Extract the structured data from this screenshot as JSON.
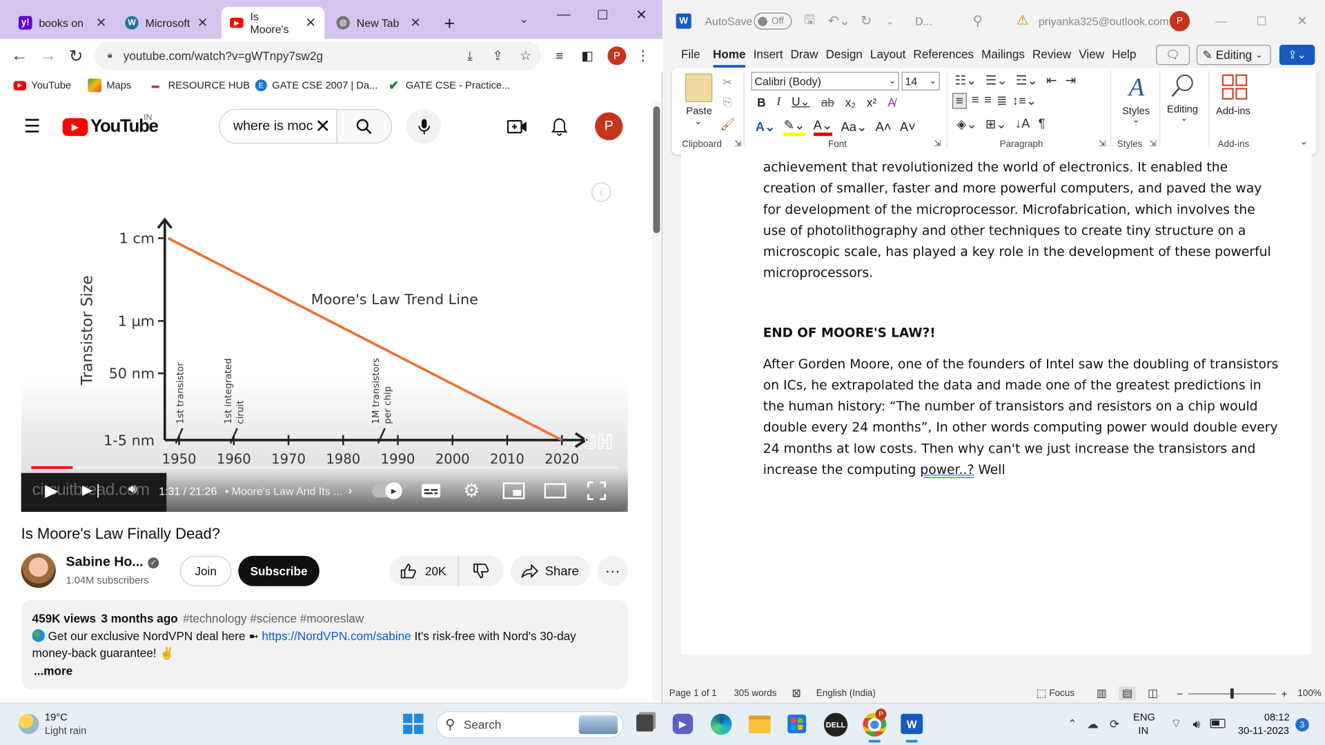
{
  "browser": {
    "tabs": [
      {
        "label": "books on",
        "icon": "yahoo-icon",
        "color": "#6001d2"
      },
      {
        "label": "Microsoft",
        "icon": "wordpress-icon",
        "color": "#21759b"
      },
      {
        "label": "Is Moore's",
        "icon": "youtube-icon",
        "color": "#ff0000"
      },
      {
        "label": "New Tab",
        "icon": "globe-icon",
        "color": "#555555"
      }
    ],
    "url": "youtube.com/watch?v=gWTnpy7sw2g",
    "profile_initial": "P",
    "bookmarks": [
      {
        "label": "YouTube",
        "icon": "youtube-icon"
      },
      {
        "label": "Maps",
        "icon": "maps-icon"
      },
      {
        "label": "RESOURCE HUB",
        "icon": "resource-icon"
      },
      {
        "label": "GATE CSE 2007 | Da...",
        "icon": "gate-icon"
      },
      {
        "label": "GATE CSE - Practice...",
        "icon": "check-icon"
      }
    ]
  },
  "youtube": {
    "logo_text": "YouTube",
    "country": "IN",
    "search_value": "where is moc",
    "avatar_initial": "P",
    "video": {
      "title": "Is Moore's Law Finally Dead?",
      "time": "1:31 / 21:26",
      "chapter": "• Moore's Law And Its ...",
      "watermark": "circuitbread.com",
      "progress_fraction": 0.071,
      "logo": "SH"
    },
    "channel": {
      "name": "Sabine Ho...",
      "subscribers": "1.04M subscribers"
    },
    "join_label": "Join",
    "subscribe_label": "Subscribe",
    "likes": "20K",
    "share_label": "Share",
    "description": {
      "views": "459K views",
      "age": "3 months ago",
      "tags": "#technology #science #mooreslaw",
      "line1_prefix": "Get our exclusive NordVPN deal here ➼",
      "link": "https://NordVPN.com/sabine",
      "line1_suffix": "It's risk-free with Nord's 30-day",
      "line2": "money-back guarantee! ✌",
      "more": "...more"
    }
  },
  "chart_data": {
    "type": "line",
    "title": "Moore's Law Trend Line",
    "ylabel": "Transistor Size",
    "xlabel": "",
    "x_ticks": [
      "1950",
      "1960",
      "1970",
      "1980",
      "1990",
      "2000",
      "2010",
      "2020"
    ],
    "y_ticks": [
      "1 cm",
      "1 µm",
      "50 nm",
      "1-5 nm"
    ],
    "series": [
      {
        "name": "",
        "x": [
          1948,
          2020
        ],
        "y": [
          "1 cm",
          "1-5 nm"
        ],
        "color": "#f07030"
      }
    ],
    "annotations": [
      {
        "x": 1950,
        "text": "1st transistor"
      },
      {
        "x": 1960,
        "text": "1st integrated ciruit"
      },
      {
        "x": 1987,
        "text": "1M transistors per chip"
      }
    ]
  },
  "word": {
    "autosave_label": "AutoSave",
    "autosave_state": "Off",
    "doc_name": "D...",
    "account": "priyanka325@outlook.com",
    "user_initial": "P",
    "menu": [
      "File",
      "Home",
      "Insert",
      "Draw",
      "Design",
      "Layout",
      "References",
      "Mailings",
      "Review",
      "View",
      "Help"
    ],
    "editing_label": "Editing",
    "ribbon": {
      "paste": "Paste",
      "clipboard": "Clipboard",
      "font_name": "Calibri (Body)",
      "font_size": "14",
      "font_group": "Font",
      "paragraph_group": "Paragraph",
      "styles": "Styles",
      "styles_group": "Styles",
      "editing": "Editing",
      "addins": "Add-ins",
      "addins_group": "Add-ins"
    },
    "doc": {
      "para1": "achievement that revolutionized the world of electronics. It enabled the creation of smaller, faster and more powerful computers, and paved the way for development of the microprocessor. Microfabrication, which involves the use of photolithography and other techniques to create tiny structure on a microscopic scale, has played a key role in the development of these powerful microprocessors.",
      "heading": "END OF MOORE'S LAW?!",
      "para2": "After Gorden Moore, one of the founders of Intel saw the doubling of transistors on ICs, he extrapolated the data and made one of the greatest predictions in the human history: “The number of transistors and resistors on a chip would double every 24 months”, In other words computing power would double every 24 months at low costs. Then why can't we just increase the transistors and increase the computing",
      "para2_underlined": "power..?",
      "para2_end": " Well"
    },
    "status": {
      "page": "Page 1 of 1",
      "words": "305 words",
      "language": "English (India)",
      "focus": "Focus",
      "zoom": "100%"
    }
  },
  "taskbar": {
    "temp": "19°C",
    "weather": "Light rain",
    "search": "Search",
    "lang1": "ENG",
    "lang2": "IN",
    "time": "08:12",
    "date": "30-11-2023",
    "notifications": "3"
  }
}
